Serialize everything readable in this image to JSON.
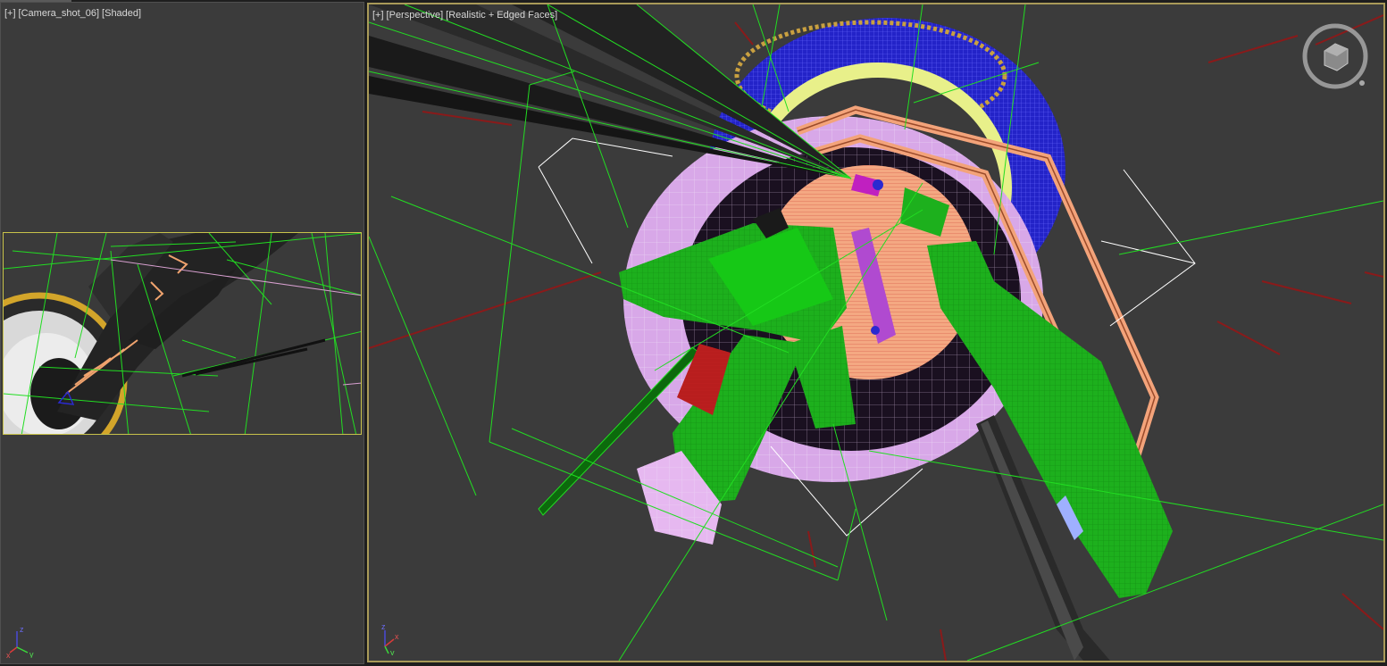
{
  "viewports": {
    "left": {
      "label": {
        "plus": "[+]",
        "view": "[Camera_shot_06]",
        "shading": "[Shaded]"
      },
      "axes": {
        "x": "x",
        "y": "y",
        "z": "z"
      }
    },
    "right": {
      "label": {
        "plus": "[+]",
        "view": "[Perspective]",
        "shading": "[Realistic + Edged Faces]"
      },
      "axes": {
        "x": "x",
        "y": "y",
        "z": "z"
      },
      "active": true
    }
  },
  "colors": {
    "viewport_bg": "#3b3b3b",
    "active_border": "#a99a58",
    "safe_frame": "#c8c24a",
    "wire_green": "#22dd22",
    "solid_green": "#1db01d",
    "wire_blue": "#2a2ad0",
    "wire_pink": "#e6b8f0",
    "orange": "#f3a37a",
    "dark_red": "#8a1a1a",
    "yellow_green": "#e8f08a"
  },
  "icons": {
    "viewcube": "viewcube-icon",
    "axis_tripod": "axis-tripod-icon"
  }
}
